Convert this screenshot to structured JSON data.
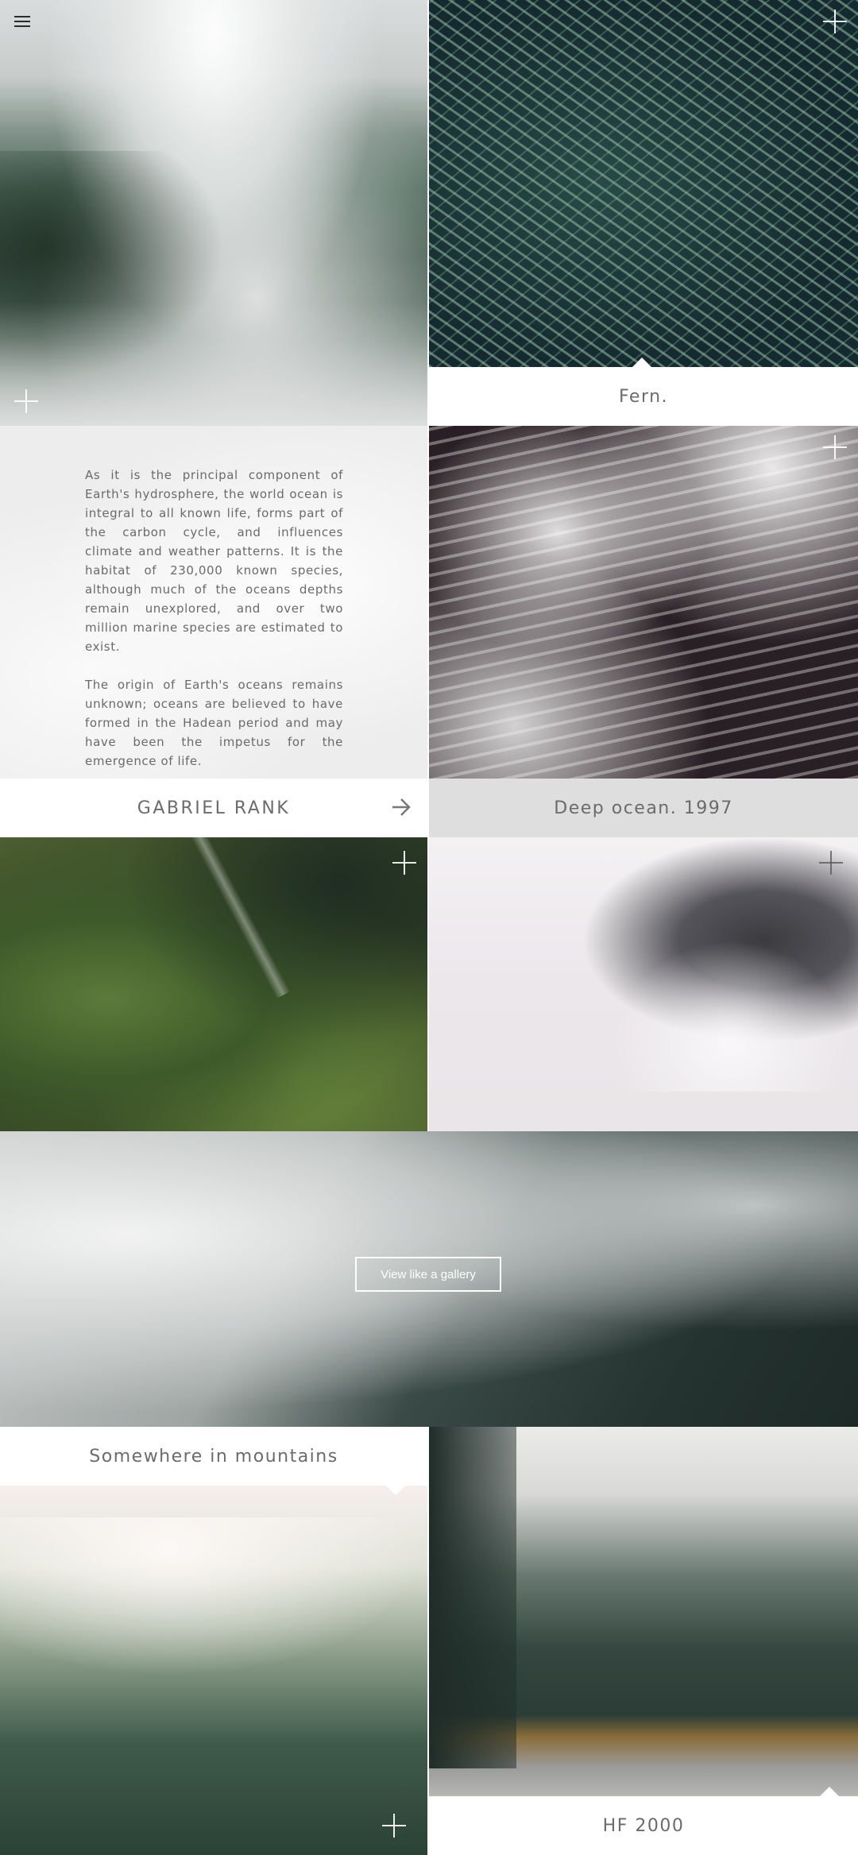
{
  "tiles": {
    "fern": {
      "caption": "Fern."
    },
    "ocean": {
      "caption": "Deep ocean. 1997"
    },
    "author": {
      "name": "GABRIEL RANK"
    },
    "mountains_caption": "Somewhere in mountains",
    "road": {
      "caption": "HF 2000"
    }
  },
  "text_panel": {
    "paragraphs": [
      "As it is the principal component of Earth's hydrosphere, the world ocean is integral to all known life, forms part of the carbon cycle, and influences climate and weather patterns. It is the habitat of 230,000 known species, although much of the oceans depths remain unexplored, and over two million marine species are estimated to exist.",
      "The origin of Earth's oceans remains unknown; oceans are believed to have formed in the Hadean period and may have been the impetus for the emergence of life."
    ]
  },
  "banner": {
    "button_label": "View like a gallery"
  },
  "icons": {
    "menu": "hamburger-icon",
    "plus": "plus-icon",
    "arrow": "arrow-right-icon"
  },
  "colors": {
    "caption_text": "#6b6b6b",
    "ocean_caption_bg": "#dedede",
    "fern_bg": "#1f3a40",
    "ocean_dark": "#2a1f24"
  }
}
